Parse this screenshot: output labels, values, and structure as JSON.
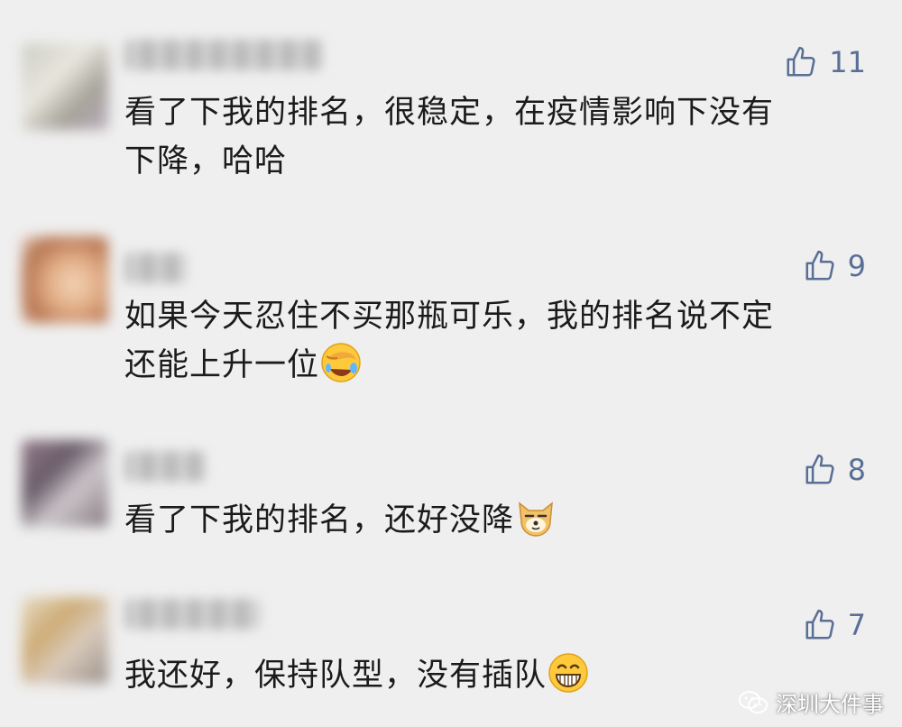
{
  "comments": [
    {
      "likes": "11",
      "text_lines": [
        "看了下我的排名，很稳定，在疫情影响下没有",
        "下降，哈哈"
      ],
      "emoji": ""
    },
    {
      "likes": "9",
      "text_lines": [
        "如果今天忍住不买那瓶可乐，我的排名说不定",
        "还能上升一位"
      ],
      "emoji": "facepalm-laugh-emoji"
    },
    {
      "likes": "8",
      "text_lines": [
        "看了下我的排名，还好没降"
      ],
      "emoji": "doge-emoji"
    },
    {
      "likes": "7",
      "text_lines": [
        "我还好，保持队型，没有插队"
      ],
      "emoji": "grin-emoji"
    }
  ],
  "watermark": {
    "text": "深圳大件事",
    "icon": "wechat-icon"
  },
  "colors": {
    "background": "#efefef",
    "like": "#5a6f96",
    "text": "#1b1b1b"
  }
}
